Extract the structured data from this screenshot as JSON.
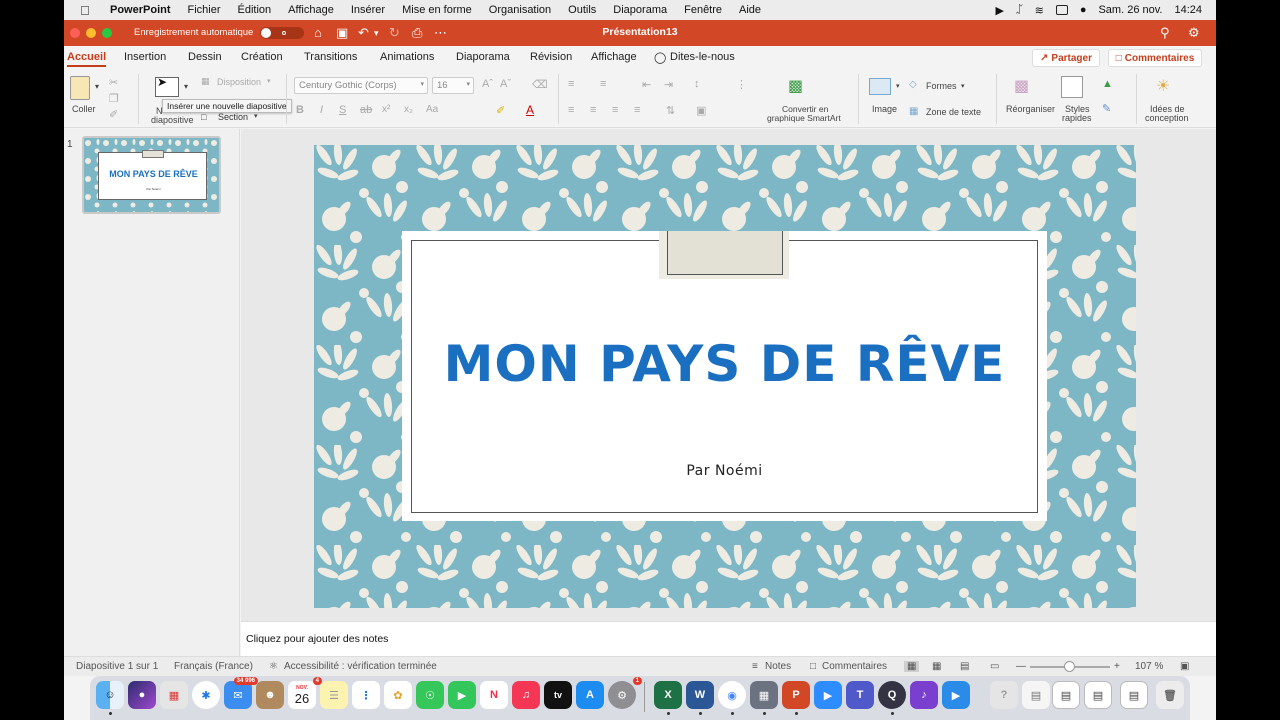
{
  "menubar": {
    "app_name": "PowerPoint",
    "items": [
      "Fichier",
      "Édition",
      "Affichage",
      "Insérer",
      "Mise en forme",
      "Organisation",
      "Outils",
      "Diaporama",
      "Fenêtre",
      "Aide"
    ],
    "date": "Sam. 26 nov.",
    "time": "14:24"
  },
  "titlebar": {
    "autosave_label": "Enregistrement automatique",
    "autosave_state": "off",
    "document_title": "Présentation13"
  },
  "tabs": {
    "items": [
      "Accueil",
      "Insertion",
      "Dessin",
      "Création",
      "Transitions",
      "Animations",
      "Diaporama",
      "Révision",
      "Affichage"
    ],
    "active": "Accueil",
    "tell_me": "Dites-le-nous",
    "share": "Partager",
    "comments": "Commentaires"
  },
  "ribbon": {
    "paste": "Coller",
    "new_slide_line1": "N",
    "new_slide_line2": "diapositive",
    "layout": "Disposition",
    "section": "Section",
    "tooltip": "Insérer une nouvelle diapositive",
    "font_name": "Century Gothic (Corps)",
    "font_size": "16",
    "smartart_line1": "Convertir en",
    "smartart_line2": "graphique SmartArt",
    "image": "Image",
    "shapes": "Formes",
    "textbox": "Zone de texte",
    "arrange": "Réorganiser",
    "quick_styles_line1": "Styles",
    "quick_styles_line2": "rapides",
    "design_ideas_line1": "Idées de",
    "design_ideas_line2": "conception"
  },
  "slides_panel": {
    "slide_number": "1",
    "thumb_title": "MON PAYS DE RÊVE",
    "thumb_subtitle": "Par Noémi"
  },
  "slide": {
    "title": "MON PAYS DE RÊVE",
    "subtitle": "Par Noémi",
    "colors": {
      "background": "#7db6c5",
      "pattern": "#eeece2",
      "title": "#1a6fc0"
    }
  },
  "notes": {
    "placeholder": "Cliquez pour ajouter des notes"
  },
  "statusbar": {
    "slide_info": "Diapositive 1 sur 1",
    "language": "Français (France)",
    "accessibility": "Accessibilité : vérification terminée",
    "notes": "Notes",
    "comments": "Commentaires",
    "zoom": "107 %"
  },
  "dock": {
    "mail_badge": "34 996",
    "calendar_month": "NOV.",
    "calendar_day": "26",
    "calendar_badge": "4",
    "settings_badge": "1"
  }
}
